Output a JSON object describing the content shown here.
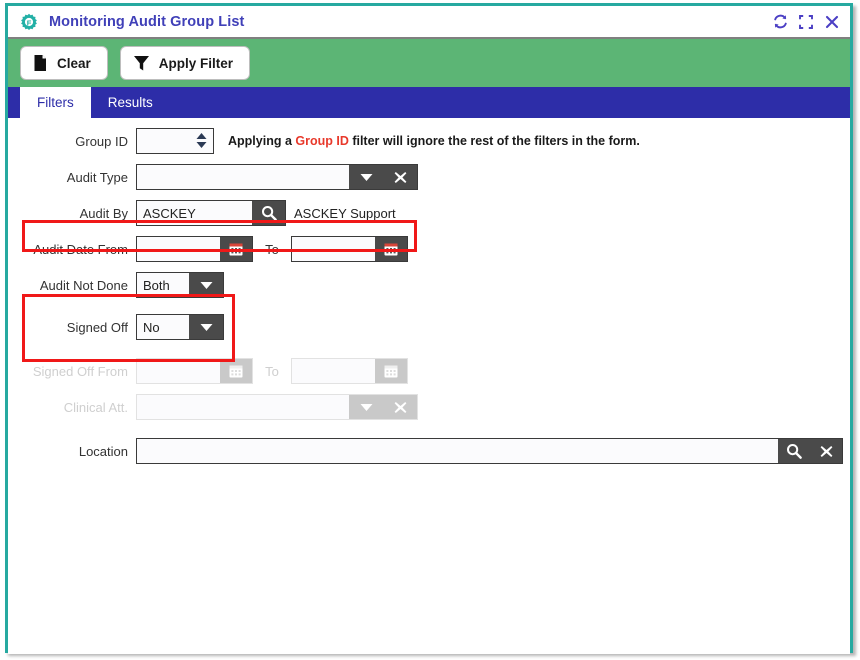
{
  "window": {
    "title": "Monitoring Audit Group List",
    "app_icon": "gear-icon",
    "accent_border": "#26a9a0",
    "controls": [
      {
        "name": "refresh-button",
        "icon": "refresh-icon"
      },
      {
        "name": "maximize-button",
        "icon": "maximize-icon"
      },
      {
        "name": "close-button",
        "icon": "close-icon"
      }
    ]
  },
  "toolbar": {
    "background": "#5cb575",
    "buttons": [
      {
        "label": "Clear",
        "icon": "document-icon"
      },
      {
        "label": "Apply Filter",
        "icon": "funnel-icon"
      }
    ]
  },
  "tabs": {
    "background": "#2d2da8",
    "items": [
      {
        "label": "Filters",
        "active": true
      },
      {
        "label": "Results",
        "active": false
      }
    ]
  },
  "form": {
    "group_id": {
      "label": "Group ID",
      "value": "",
      "placeholder": "",
      "hint_before": "Applying a ",
      "hint_highlight": "Group ID",
      "hint_after": " filter will ignore the rest of the filters in the form.",
      "hint_highlight_color": "#e8392b"
    },
    "audit_type": {
      "label": "Audit Type",
      "value": "",
      "placeholder": "",
      "dropdown_icon": "chevron-down-icon",
      "clear_icon": "close-icon"
    },
    "audit_by": {
      "label": "Audit By",
      "value": "ASCKEY",
      "placeholder": "",
      "search_icon": "search-icon",
      "resolved_name": "ASCKEY Support",
      "highlighted": true
    },
    "audit_date": {
      "label": "Audit Date From",
      "from_value": "",
      "to_label": "To",
      "to_value": "",
      "calendar_icon": "calendar-icon"
    },
    "audit_not_done": {
      "label": "Audit Not Done",
      "value": "Both",
      "dropdown_icon": "chevron-down-icon",
      "highlighted": true
    },
    "signed_off": {
      "label": "Signed Off",
      "value": "No",
      "dropdown_icon": "chevron-down-icon",
      "highlighted": true
    },
    "signed_off_date": {
      "label": "Signed Off From",
      "from_value": "",
      "to_label": "To",
      "to_value": "",
      "calendar_icon": "calendar-icon",
      "disabled": true
    },
    "clinical_att": {
      "label": "Clinical Att.",
      "value": "",
      "dropdown_icon": "chevron-down-icon",
      "clear_icon": "close-icon",
      "disabled": true
    },
    "location": {
      "label": "Location",
      "value": "",
      "placeholder": "",
      "search_icon": "search-icon",
      "clear_icon": "close-icon"
    }
  },
  "annotations": {
    "highlight_color": "#f01818",
    "boxes": [
      {
        "name": "audit-by-highlight"
      },
      {
        "name": "audit-flags-highlight"
      }
    ]
  }
}
